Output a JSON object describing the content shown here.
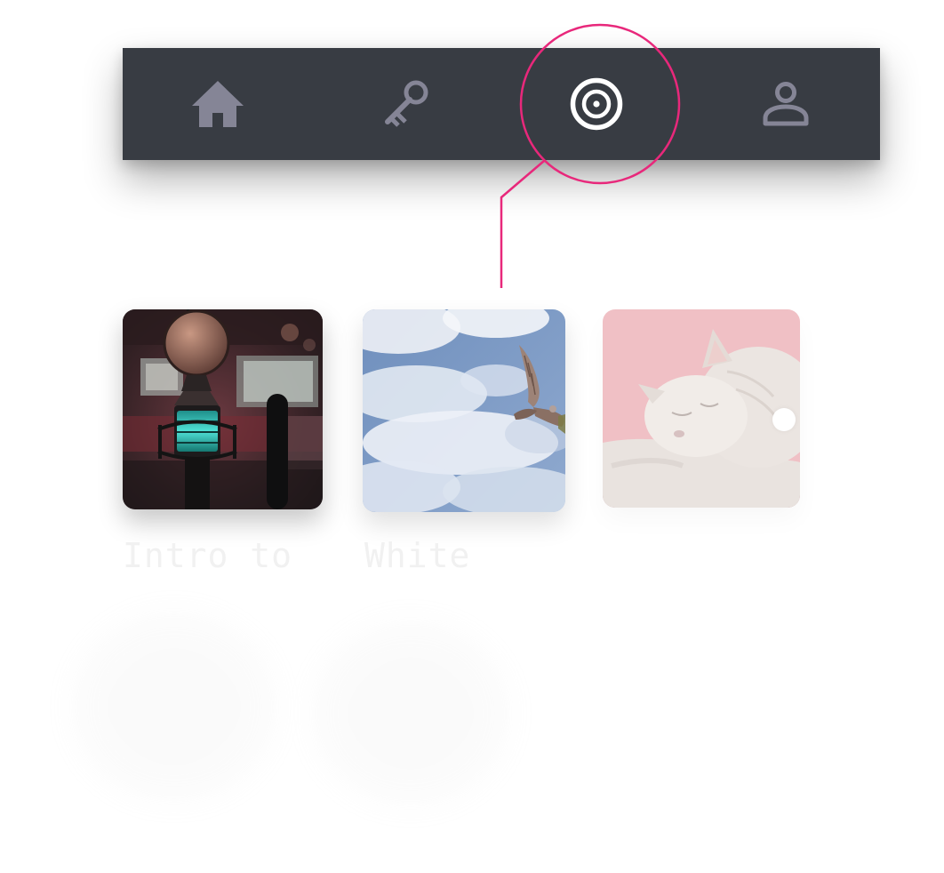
{
  "nav": {
    "items": [
      {
        "icon": "home-icon",
        "active": false
      },
      {
        "icon": "key-icon",
        "active": false
      },
      {
        "icon": "discover-target-icon",
        "active": true
      },
      {
        "icon": "profile-icon",
        "active": false
      }
    ],
    "colors": {
      "bar_background": "#383c43",
      "icon_inactive": "#858596",
      "icon_active": "#ffffff",
      "highlight_ring": "#e8287b"
    }
  },
  "cards": [
    {
      "image": "studio-microphone-photo",
      "title": "Intro to"
    },
    {
      "image": "hawk-in-sky-photo",
      "title": "White"
    },
    {
      "image": "sleeping-cat-photo",
      "title": ""
    }
  ]
}
